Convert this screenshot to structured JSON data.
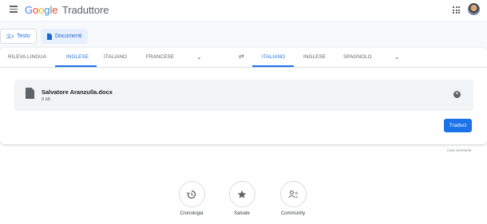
{
  "header": {
    "logo_letters": [
      "G",
      "o",
      "o",
      "g",
      "l",
      "e"
    ],
    "product": "Traduttore"
  },
  "modes": {
    "text_label": "Testo",
    "documents_label": "Documenti"
  },
  "source_langs": [
    "RILEVA LINGUA",
    "INGLESE",
    "ITALIANO",
    "FRANCESE"
  ],
  "target_langs": [
    "ITALIANO",
    "INGLESE",
    "SPAGNOLO"
  ],
  "file": {
    "name": "Salvatore Aranzulla.docx",
    "size": "8 kB"
  },
  "translate_button": "Traduci",
  "feedback_link": "Invia commenti",
  "actions": [
    {
      "label": "Cronologia",
      "icon": "history-icon"
    },
    {
      "label": "Salvate",
      "icon": "star-icon"
    },
    {
      "label": "Community",
      "icon": "community-icon"
    }
  ],
  "colors": {
    "accent": "#1a73e8",
    "active_tab_bg": "#e8f0fe"
  }
}
